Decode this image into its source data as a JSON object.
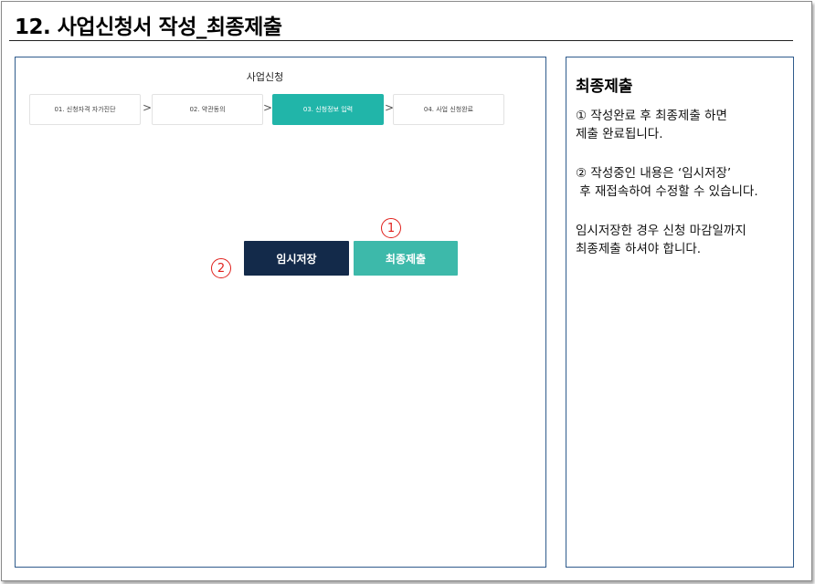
{
  "page": {
    "title": "12. 사업신청서 작성_최종제출"
  },
  "screenshot": {
    "header": "사업신청",
    "steps": [
      {
        "label": "01. 신청자격 자가진단",
        "active": false
      },
      {
        "label": "02. 약관동의",
        "active": false
      },
      {
        "label": "03. 신청정보 입력",
        "active": true
      },
      {
        "label": "04. 사업 신청완료",
        "active": false
      }
    ],
    "arrow_glyph": ">",
    "buttons": {
      "temp_save": "임시저장",
      "final_submit": "최종제출"
    },
    "markers": {
      "one": "1",
      "two": "2"
    }
  },
  "side_panel": {
    "title": "최종제출",
    "notes": [
      "① 작성완료 후 최종제출 하면\n제출 완료됩니다.",
      "② 작성중인 내용은 ‘임시저장’\n 후 재접속하여 수정할 수 있습니다.",
      "임시저장한 경우 신청 마감일까지\n최종제출 하셔야 합니다."
    ]
  },
  "colors": {
    "active_step": "#21b5a9",
    "temp_save_button": "#132a4a",
    "final_submit_button": "#3db9aa",
    "marker": "#e0201c",
    "panel_border": "#2f5b8c"
  }
}
